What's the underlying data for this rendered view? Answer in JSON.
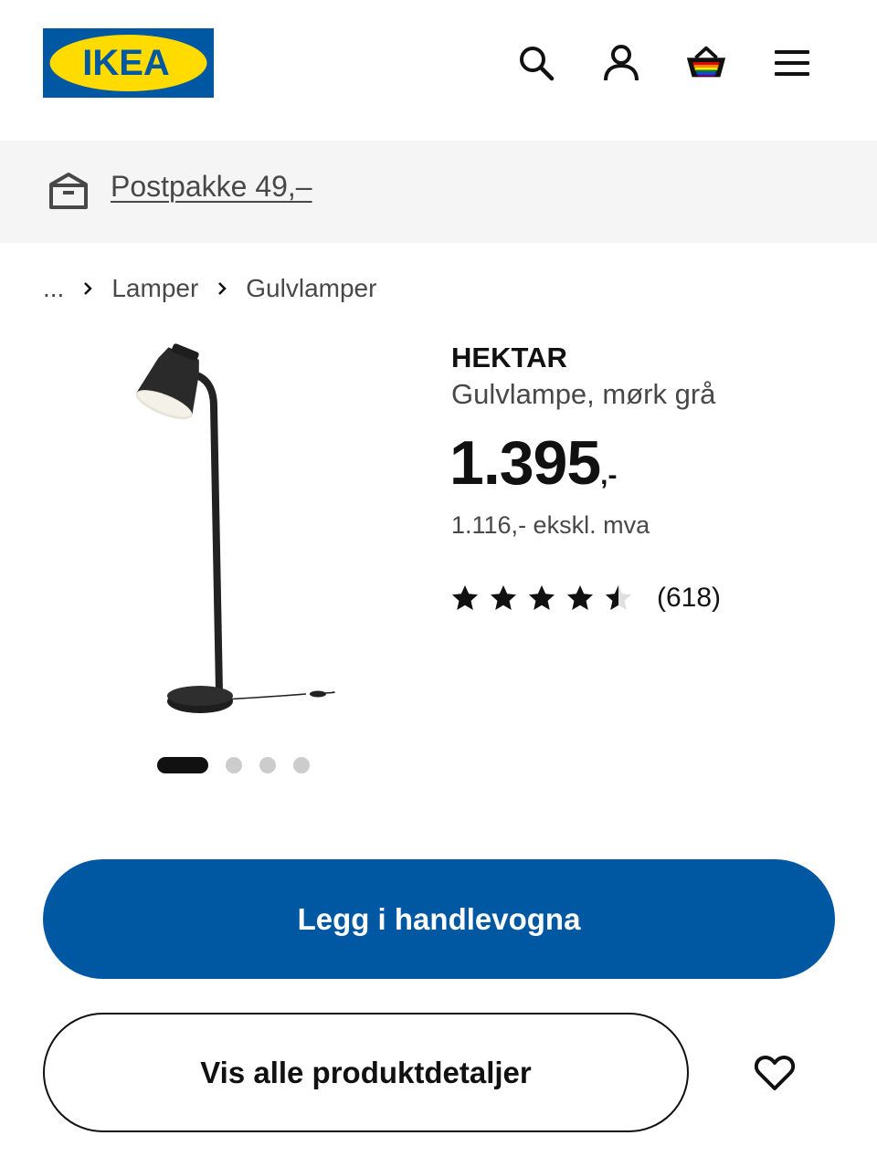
{
  "header": {
    "logo_text": "IKEA",
    "logo_icon": "ikea-logo",
    "icons": [
      "search-icon",
      "account-icon",
      "basket-icon",
      "menu-icon"
    ]
  },
  "banner": {
    "icon": "delivery-box-icon",
    "link_text": "Postpakke 49,–"
  },
  "breadcrumb": {
    "items": [
      "...",
      "Lamper",
      "Gulvlamper"
    ]
  },
  "product": {
    "name": "HEKTAR",
    "description": "Gulvlampe, mørk grå",
    "price_integer": "1.395",
    "price_suffix": ",-",
    "price_ex_vat": "1.116,- ekskl. mva",
    "rating_value": 4.5,
    "rating_max": 5,
    "rating_count": "(618)",
    "image_icon": "floor-lamp-image"
  },
  "carousel": {
    "total": 4,
    "active_index": 0
  },
  "actions": {
    "add_to_cart": "Legg i handlevogna",
    "show_details": "Vis alle produktdetaljer",
    "favourite_icon": "heart-icon"
  },
  "colors": {
    "brand_blue": "#0058a3",
    "brand_yellow": "#ffdb00",
    "banner_bg": "#f5f5f5",
    "text_dark": "#111111",
    "text_muted": "#484848"
  }
}
